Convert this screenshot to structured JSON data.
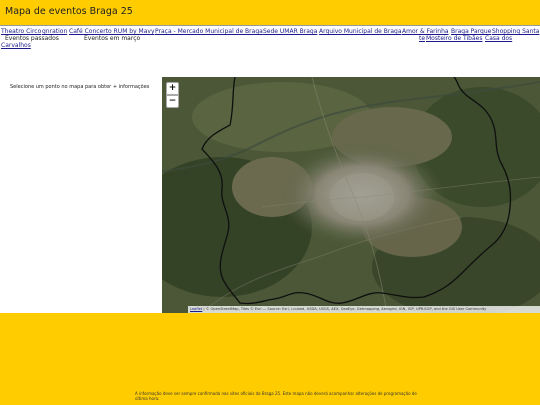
{
  "header": {
    "title": "Mapa de eventos Braga 25"
  },
  "nav": {
    "links": [
      "Theatro Circo",
      "gnration",
      "Café Concerto RUM by Mavy",
      "Praça - Mercado Municipal de Braga",
      "Sede UMAR Braga",
      "Arquivo Municipal de Braga",
      "Amor & Farinha",
      "Braga Parque",
      "Shopping Santa",
      "te",
      "Mosteiro de Tibães",
      "Casa dos",
      "Carvalhos"
    ],
    "past_events": "Eventos passados",
    "march_events": "Eventos em março"
  },
  "sidebar": {
    "prompt": "Selecione um ponto no mapa para obter + informações"
  },
  "map": {
    "zoom_in": "+",
    "zoom_out": "−",
    "attribution_link": "Leaflet",
    "attribution_text": " | © OpenStreetMap, Tiles © Esri — Source: Esri, i-cubed, USDA, USGS, AEX, GeoEye, Getmapping, Aerogrid, IGN, IGP, UPR-EGP, and the GIS User Community"
  },
  "footer": {
    "note": "A informação deve ser sempre confirmada nas sites oficiais da Braga 25. Este mapa não deverá acompanhar alterações de programação de última hora."
  },
  "colors": {
    "brand_yellow": "#ffcc00",
    "link": "#1a1a8c"
  }
}
